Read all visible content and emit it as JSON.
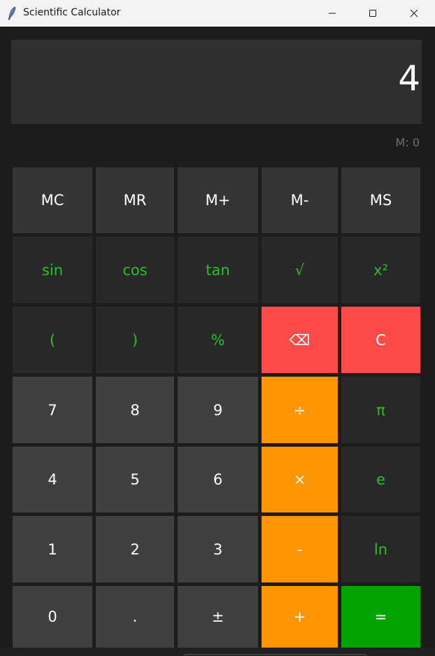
{
  "window": {
    "title": "Scientific Calculator",
    "icon": "feather-icon"
  },
  "display": {
    "value": "4",
    "memory": "M: 0"
  },
  "buttons": {
    "mc": "MC",
    "mr": "MR",
    "mplus": "M+",
    "mminus": "M-",
    "ms": "MS",
    "sin": "sin",
    "cos": "cos",
    "tan": "tan",
    "sqrt": "√",
    "square": "x²",
    "lparen": "(",
    "rparen": ")",
    "percent": "%",
    "backspace": "⌫",
    "clear": "C",
    "seven": "7",
    "eight": "8",
    "nine": "9",
    "divide": "÷",
    "pi": "π",
    "four": "4",
    "five": "5",
    "six": "6",
    "multiply": "×",
    "e": "e",
    "one": "1",
    "two": "2",
    "three": "3",
    "minus": "-",
    "ln": "ln",
    "zero": "0",
    "dot": ".",
    "plusminus": "±",
    "plus": "+",
    "equals": "="
  },
  "colors": {
    "background": "#1c1c1c",
    "display": "#2f2f2f",
    "function_text": "#22c322",
    "operator": "#ff9500",
    "clear": "#ff4a4a",
    "equals": "#00a300"
  }
}
